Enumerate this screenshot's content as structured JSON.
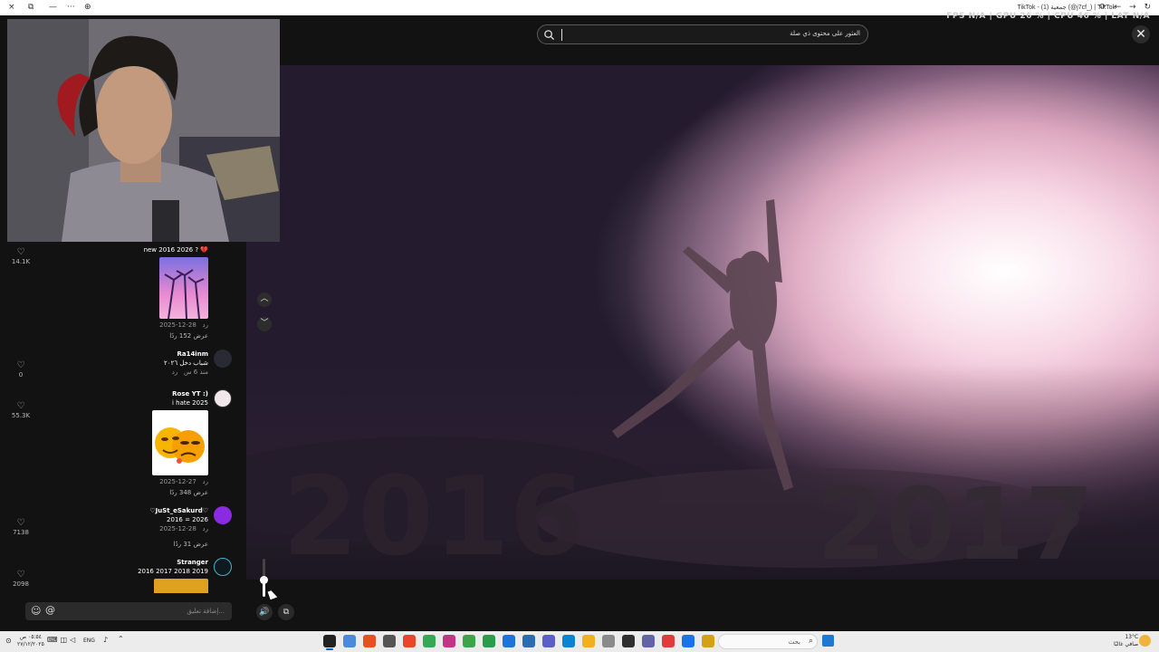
{
  "window": {
    "title": "TikTok - (1) جمعية (@j7cf_) | TikTok",
    "controls": {
      "close": "×",
      "restore": "⧉",
      "minimize": "—",
      "more": "···",
      "extra": "⊕"
    },
    "nav": "⟳ ← → ↻"
  },
  "topbar": {
    "search_placeholder": "العثور على محتوى ذي صلة",
    "stats": "FPS N/A  |  GPU 26 %  |  CPU 46 %  |  LAT N/A",
    "close_label": "✕"
  },
  "comments": [
    {
      "name": "",
      "text": "new 2016 2026 ? 💔",
      "likes": "14.1K",
      "date": "2025-12-28",
      "reply": "رد",
      "view_replies": "عرض 152 ردًا",
      "has_image": true,
      "image_kind": "palms"
    },
    {
      "name": "Ra14inm",
      "text": "شباب دخل ٢٠٢٦",
      "likes": "0",
      "date": "منذ 6 س",
      "reply": "رد",
      "view_replies": "",
      "has_image": false
    },
    {
      "name": "Rose YT :)",
      "text": "i hate 2025",
      "likes": "55.3K",
      "date": "2025-12-27",
      "reply": "رد",
      "view_replies": "عرض 348 ردًا",
      "has_image": true,
      "image_kind": "emoji"
    },
    {
      "name": "♡JuSt_eSakurd♡",
      "text": "2016 = 2026",
      "likes": "7138",
      "date": "2025-12-28",
      "reply": "رد",
      "view_replies": "عرض 31 ردًا",
      "has_image": false
    },
    {
      "name": "Stranger",
      "text": "2016 2017 2018 2019",
      "likes": "2098",
      "date": "",
      "reply": "",
      "view_replies": "",
      "has_image": false
    }
  ],
  "comment_input": {
    "placeholder": "إضافة تعليق...",
    "emoji": "☺",
    "at": "@"
  },
  "player": {
    "up": "︿",
    "down": "﹀",
    "volume_icon": "🔊",
    "pip_icon": "⧉",
    "volume_level": 0.5
  },
  "video": {
    "left_year": "2016",
    "right_year": "2017"
  },
  "taskbar": {
    "clock_time": "٠٥:٥٤ ص",
    "clock_date": "٢٧/١٢/٢٠٢٥",
    "lang": "ENG",
    "search_placeholder": "بحث",
    "search_icon": "⌕",
    "weather_temp": "13°C",
    "weather_text": "صافي غالبًا",
    "icons": [
      "#222",
      "#4a89dc",
      "#e8501f",
      "#555",
      "#e8452c",
      "#34a853",
      "#c13584",
      "#3ea34a",
      "#2a9d4a",
      "#1e73d8",
      "#2b6cb0",
      "#5b5fc7",
      "#0a84d0",
      "#f2b01e",
      "#8a8a8a",
      "#2f2f2f",
      "#6264a7",
      "#e03a3a",
      "#1a73e8",
      "#d4a017",
      "#6d6d6d",
      "#777"
    ]
  }
}
